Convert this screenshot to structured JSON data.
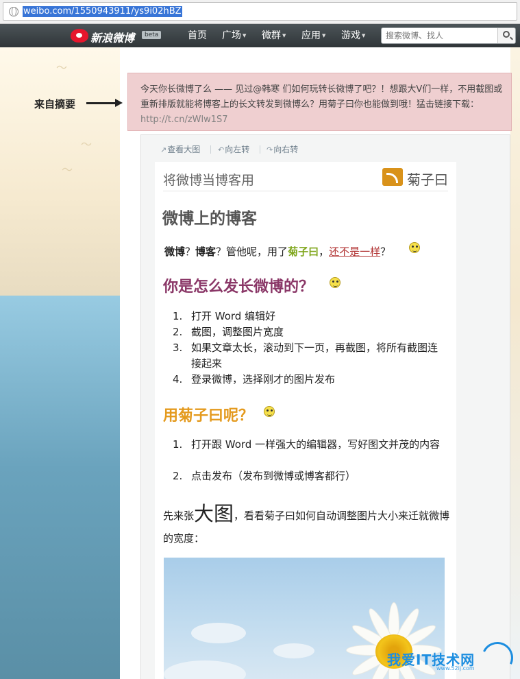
{
  "browser": {
    "url": "weibo.com/1550943911/ys9i02hBZ"
  },
  "nav": {
    "logo_text": "新浪微博",
    "logo_badge": "beta",
    "items": [
      {
        "label": "首页",
        "dropdown": false
      },
      {
        "label": "广场",
        "dropdown": true
      },
      {
        "label": "微群",
        "dropdown": true
      },
      {
        "label": "应用",
        "dropdown": true
      },
      {
        "label": "游戏",
        "dropdown": true
      }
    ],
    "search_placeholder": "搜索微博、找人"
  },
  "annotation": {
    "label": "来自摘要"
  },
  "summary": {
    "text": "今天你长微博了么 —— 见过@韩寒 们如何玩转长微博了吧？！想跟大V们一样，不用截图或重新排版就能将博客上的长文转发到微博么？用菊子曰你也能做到哦！猛击链接下载：",
    "link": "http://t.cn/zWlw1S7"
  },
  "actions": {
    "view_large": "查看大图",
    "rotate_left": "向左转",
    "rotate_right": "向右转"
  },
  "article": {
    "header_title": "将微博当博客用",
    "brand": "菊子曰",
    "h1": "微博上的博客",
    "line1": {
      "weibo": "微博",
      "q1": "？",
      "blog": "博客",
      "mid": "？管他呢，用了",
      "brand": "菊子曰",
      "comma": "，",
      "link": "还不是一样",
      "end": "？"
    },
    "h2a": "你是怎么发长微博的？",
    "list_a": [
      {
        "n": "1.",
        "t": "打开 Word 编辑好"
      },
      {
        "n": "2.",
        "t": "截图，调整图片宽度"
      },
      {
        "n": "3.",
        "t": "如果文章太长，滚动到下一页，再截图，将所有截图连接起来"
      },
      {
        "n": "4.",
        "t": "登录微博，选择刚才的图片发布"
      }
    ],
    "h2b": "用菊子曰呢？",
    "list_b": [
      {
        "n": "1.",
        "t": "打开跟 Word 一样强大的编辑器，写好图文并茂的内容"
      },
      {
        "n": "2.",
        "t": "点击发布（发布到微博或博客都行）"
      }
    ],
    "para": {
      "pre": "先来张",
      "big": "大图",
      "post": "，看看菊子曰如何自动调整图片大小来迁就微博的宽度："
    }
  },
  "watermark": {
    "text": "我爱IT技术网",
    "sub": "www.52ij.com"
  },
  "colors": {
    "nav_bg": "#3a4044",
    "summary_bg": "#efcfd0",
    "heading_purple": "#8a3767",
    "heading_orange": "#e49a1e",
    "brand_green": "#7fa61c",
    "link_red": "#b03030"
  }
}
